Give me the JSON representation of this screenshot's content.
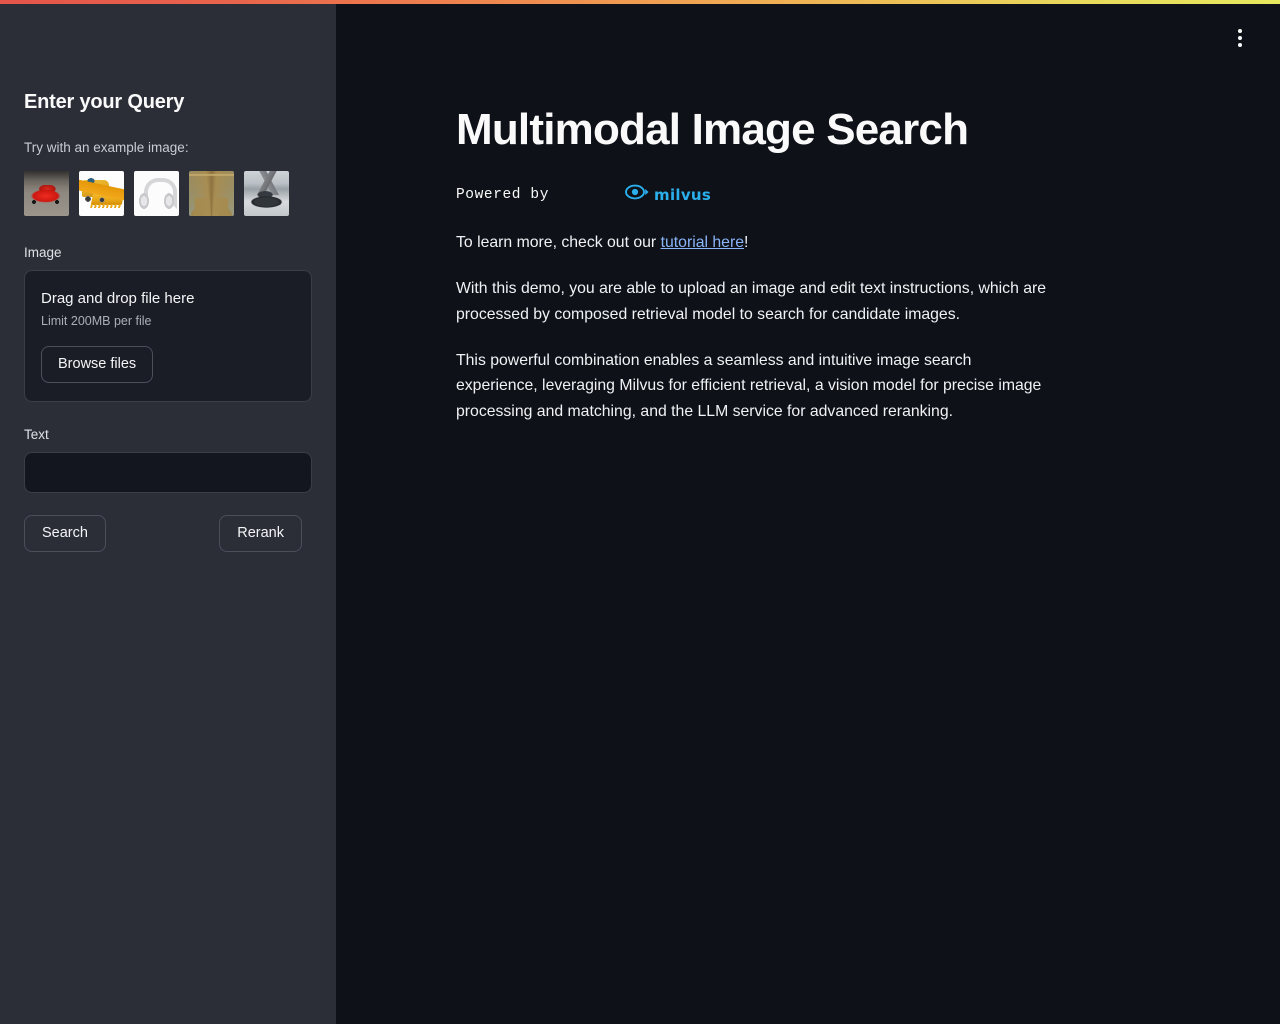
{
  "theme": {
    "sidebar_bg": "#2b2d37",
    "main_bg": "#0e1117",
    "accent_link": "#8ab4f8",
    "milvus_blue": "#2ab0ec",
    "gradient_from": "#e4554a",
    "gradient_to": "#e7e95e",
    "text_primary": "#fafafa",
    "text_secondary": "#a9aeb8"
  },
  "sidebar": {
    "title": "Enter your Query",
    "example_label": "Try with an example image:",
    "examples": [
      {
        "name": "red-sports-car",
        "alt": "Red sports car"
      },
      {
        "name": "yellow-wheel-loader",
        "alt": "Yellow wheel loader"
      },
      {
        "name": "white-headphones",
        "alt": "White over-ear headphones"
      },
      {
        "name": "eiffel-tower",
        "alt": "Eiffel Tower"
      },
      {
        "name": "dark-sedan",
        "alt": "Dark sedan car"
      }
    ],
    "image_widget": {
      "label": "Image",
      "dropzone_title": "Drag and drop file here",
      "dropzone_limit": "Limit 200MB per file",
      "browse_label": "Browse files"
    },
    "text_widget": {
      "label": "Text",
      "value": "",
      "placeholder": ""
    },
    "buttons": {
      "search_label": "Search",
      "rerank_label": "Rerank"
    }
  },
  "header": {
    "menu_icon": "kebab-menu-icon"
  },
  "main": {
    "title": "Multimodal Image Search",
    "powered_by_text": "Powered by",
    "milvus_wordmark": "milvus",
    "milvus_icon": "milvus-eye-icon",
    "tutorial_line_prefix": "To learn more, check out our ",
    "tutorial_link_label": "tutorial here",
    "tutorial_line_suffix": "!",
    "paragraph_1": "With this demo, you are able to upload an image and edit text instructions, which are processed by composed retrieval model to search for candidate images.",
    "paragraph_2": "This powerful combination enables a seamless and intuitive image search experience, leveraging Milvus for efficient retrieval, a vision model for precise image processing and matching, and the LLM service for advanced reranking."
  }
}
